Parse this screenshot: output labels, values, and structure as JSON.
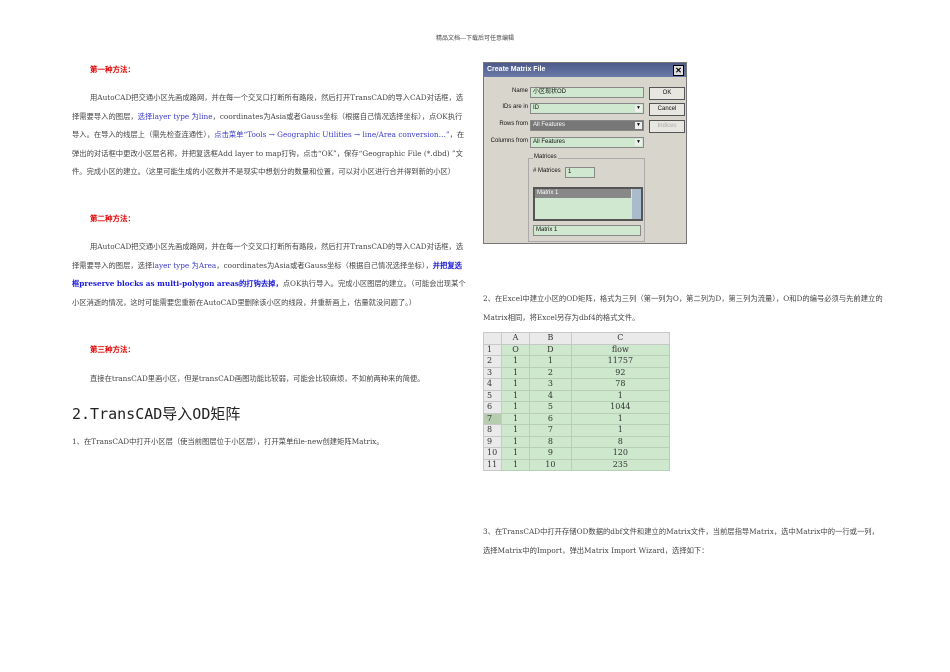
{
  "header": "精品文档---下载后可任意编辑",
  "method1": {
    "title": "第一种方法：",
    "segments": [
      {
        "t": "用AutoCAD把交通小区先画成路网，并在每一个交叉口打断所有路段，然后打开TransCAD的导入CAD对话框，选择需要导入的图层，",
        "s": ""
      },
      {
        "t": "选择layer type 为line",
        "s": "blue"
      },
      {
        "t": "，coordinates为Asia或者Gauss坐标（根据自己情况选择坐标），点OK执行导入。在导入的线层上（需先检查连通性），",
        "s": ""
      },
      {
        "t": "点击菜单“Tools → Geographic Utilities → line/Area conversion…”",
        "s": "blue"
      },
      {
        "t": "，在弹出的对话框中更改小区层名称，并把复选框Add layer to map打钩，点击“OK”，保存“Geographic File (*.dbd) ”文件。完成小区的建立。（这里可能生成的小区数并不是现实中想划分的数量和位置，可以对小区进行合并得到新的小区）",
        "s": ""
      }
    ]
  },
  "method2": {
    "title": "第二种方法：",
    "segments": [
      {
        "t": "用AutoCAD把交通小区先画成路网，并在每一个交叉口打断所有路段，然后打开TransCAD的导入CAD对话框，选择需要导入的图层，选择",
        "s": ""
      },
      {
        "t": "layer type 为Area",
        "s": "blue"
      },
      {
        "t": "，coordinates为Asia或者Gauss坐标（根据自己情况选择坐标），",
        "s": ""
      },
      {
        "t": "并把复选框preserve  blocks  as  multi-polygon  areas的打钩去掉，",
        "s": "bb"
      },
      {
        "t": "点OK执行导入。完成小区图层的建立。（可能会出现某个小区消逝的情况，这时可能需要您重新在AutoCAD里删除该小区的线段，并重新画上，估量就没问题了。）",
        "s": ""
      }
    ]
  },
  "method3": {
    "title": "第三种方法：",
    "text": "直接在transCAD里画小区，但是transCAD画图功能比较弱，可能会比较麻烦，不如前两种来的简便。"
  },
  "section2": {
    "title": "2.TransCAD导入OD矩阵",
    "step1": "1、在TransCAD中打开小区层（使当前图层位于小区层），打开菜单file-new创建矩阵Matrix。",
    "step2": "2、在Excel中建立小区的OD矩阵，格式为三列（第一列为O，第二列为D，第三列为流量），O和D的编号必须与先前建立的Matrix相同，将Excel另存为dbf4的格式文件。",
    "step3": "3、在TransCAD中打开存储OD数据的dbf文件和建立的Matrix文件，当前层指导Matrix，选中Matrix中的一行或一列，选择Matrix中的Import，弹出Matrix Import Wizard，选择如下："
  },
  "dialog": {
    "title": "Create Matrix File",
    "close": "✕",
    "name_label": "Name",
    "name_value": "小区现状OD",
    "ids_label": "IDs are in",
    "ids_value": "ID",
    "rows_label": "Rows from",
    "rows_value": "All Features",
    "cols_label": "Columns from",
    "cols_value": "All Features",
    "ok": "OK",
    "cancel": "Cancel",
    "indices": "Indices",
    "matrices_group": "Matrices",
    "num_label": "# Matrices",
    "num_value": "1",
    "list_item": "Matrix 1",
    "matrix_name": "Matrix 1"
  },
  "sheet": {
    "columns": [
      "A",
      "B",
      "C"
    ],
    "rows": [
      [
        "1",
        "O",
        "D",
        "flow"
      ],
      [
        "2",
        "1",
        "1",
        "11757"
      ],
      [
        "3",
        "1",
        "2",
        "92"
      ],
      [
        "4",
        "1",
        "3",
        "78"
      ],
      [
        "5",
        "1",
        "4",
        "1"
      ],
      [
        "6",
        "1",
        "5",
        "1044"
      ],
      [
        "7",
        "1",
        "6",
        "1"
      ],
      [
        "8",
        "1",
        "7",
        "1"
      ],
      [
        "9",
        "1",
        "8",
        "8"
      ],
      [
        "10",
        "1",
        "9",
        "120"
      ],
      [
        "11",
        "1",
        "10",
        "235"
      ]
    ]
  }
}
